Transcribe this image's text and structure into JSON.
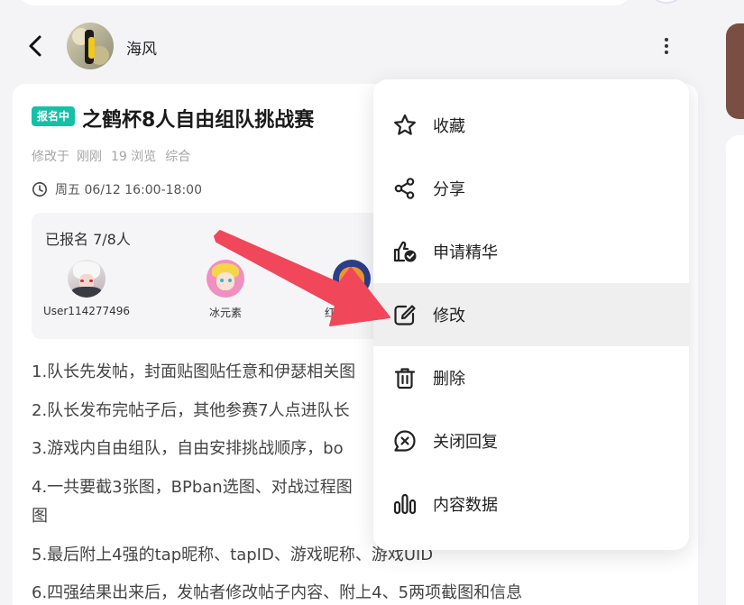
{
  "header": {
    "author_name": "海风"
  },
  "post": {
    "status_badge": "报名中",
    "title": "之鹤杯8人自由组队挑战赛",
    "meta": {
      "edited_prefix": "修改于",
      "edited_time": "刚刚",
      "views": "19 浏览",
      "category": "综合"
    },
    "schedule": "周五 06/12 16:00-18:00",
    "signup": {
      "title": "已报名 7/8人",
      "members": [
        {
          "name": "User114277496"
        },
        {
          "name": "冰元素"
        },
        {
          "name": "红红小奶猫"
        }
      ]
    },
    "content_lines": [
      "1.队长先发帖，封面贴图贴任意和伊瑟相关图",
      "2.队长发布完帖子后，其他参赛7人点进队长",
      "3.游戏内自由组队，自由安排挑战顺序，bo",
      "4.一共要截3张图，BPban选图、对战过程图",
      "图",
      "5.最后附上4强的tap昵称、tapID、游戏昵称、游戏UID",
      "6.四强结果出来后，发帖者修改帖子内容、附上4、5两项截图和信息"
    ]
  },
  "menu": {
    "items": [
      {
        "label": "收藏",
        "icon": "star-icon"
      },
      {
        "label": "分享",
        "icon": "share-icon"
      },
      {
        "label": "申请精华",
        "icon": "thumbs-up-badge-icon"
      },
      {
        "label": "修改",
        "icon": "edit-icon"
      },
      {
        "label": "删除",
        "icon": "trash-icon"
      },
      {
        "label": "关闭回复",
        "icon": "close-comment-icon"
      },
      {
        "label": "内容数据",
        "icon": "bar-chart-icon"
      }
    ],
    "highlighted_item": "修改"
  },
  "colors": {
    "badge": "#14c1a7",
    "arrow": "#f0475a",
    "menu_highlight": "#efefef"
  }
}
